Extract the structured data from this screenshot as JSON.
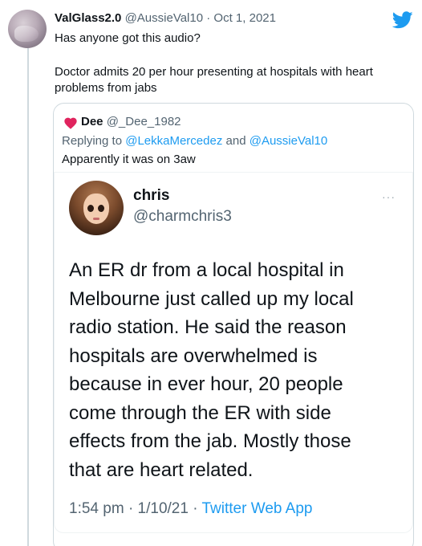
{
  "tweet": {
    "display_name": "ValGlass2.0",
    "handle": "@AussieVal10",
    "separator": "·",
    "date": "Oct 1, 2021",
    "text_line1": "Has anyone got this audio?",
    "text_line2": "Doctor admits 20 per hour presenting at hospitals with heart problems from jabs"
  },
  "quoted": {
    "display_name": "Dee",
    "handle": "@_Dee_1982",
    "replying_prefix": "Replying to",
    "replying_mention1": "@LekkaMercedez",
    "replying_and": "and",
    "replying_mention2": "@AussieVal10",
    "text": "Apparently it was on 3aw"
  },
  "embedded": {
    "display_name": "chris",
    "handle": "@charmchris3",
    "more": "···",
    "body_lines": [
      "An ER dr from a local hospital in",
      "Melbourne just called up my local",
      "radio station. He said the reason",
      "hospitals are overwhelmed is",
      "because in ever hour, 20 people",
      "come through the ER with side",
      "effects from the jab. Mostly those",
      "that are heart related."
    ],
    "time": "1:54 pm",
    "separator": "·",
    "date": "1/10/21",
    "separator2": "·",
    "app": "Twitter Web App"
  },
  "icons": {
    "brand": "twitter-bird-icon",
    "heart": "heart-icon"
  },
  "colors": {
    "accent": "#1d9bf0",
    "secondary_text": "#536471",
    "heart": "#e0245e"
  }
}
